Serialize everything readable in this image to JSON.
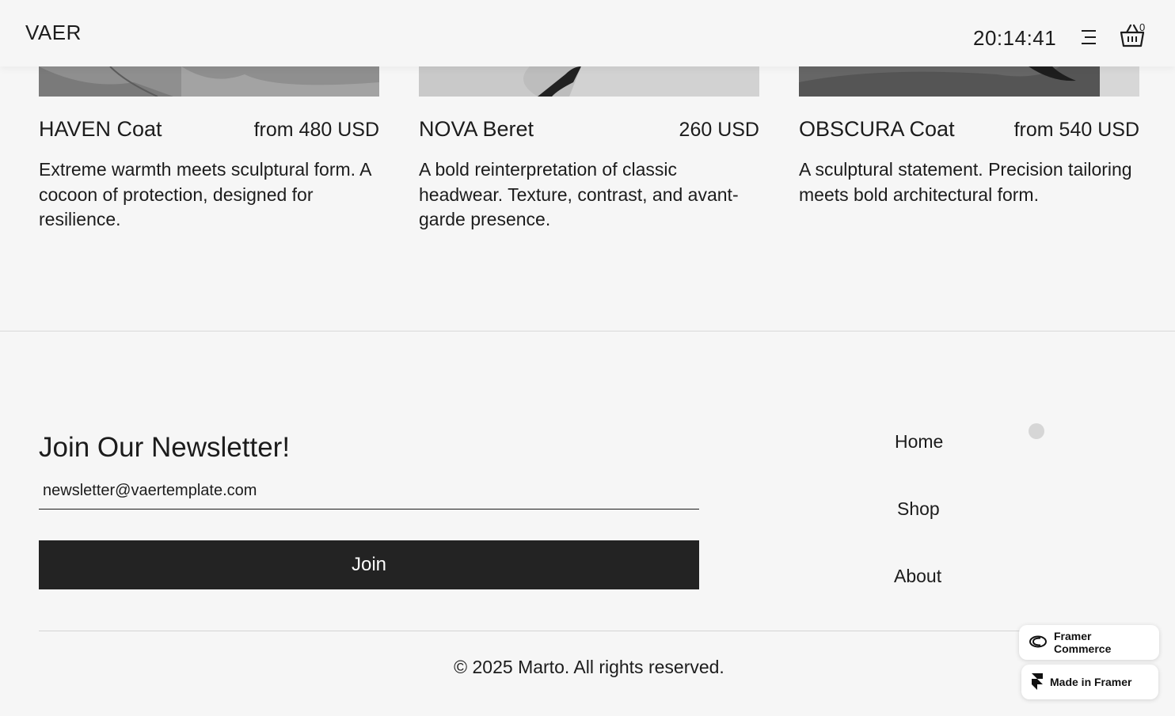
{
  "header": {
    "logo": "VAER",
    "clock": "20:14:41",
    "menu_icon": "menu-icon",
    "cart_icon": "shopping-basket-icon",
    "cart_count": "0"
  },
  "products": [
    {
      "name": "HAVEN Coat",
      "price": "from 480 USD",
      "description": "Extreme warmth meets sculptural form. A cocoon of protection, designed for resilience."
    },
    {
      "name": "NOVA Beret",
      "price": "260 USD",
      "description": "A bold reinterpretation of classic headwear. Texture, contrast, and avant-garde presence."
    },
    {
      "name": "OBSCURA Coat",
      "price": "from 540 USD",
      "description": "A sculptural statement. Precision tailoring meets bold architectural form."
    }
  ],
  "newsletter": {
    "title": "Join Our Newsletter!",
    "placeholder": "newsletter@vaertemplate.com",
    "button_label": "Join"
  },
  "footer_nav": [
    "Home",
    "Shop",
    "About"
  ],
  "copyright": "© 2025 Marto. All rights reserved.",
  "badges": {
    "commerce": "Framer Commerce",
    "made_in": "Made in Framer"
  },
  "colors": {
    "background": "#f6f6f6",
    "text": "#1c1c1c",
    "button": "#232323"
  }
}
